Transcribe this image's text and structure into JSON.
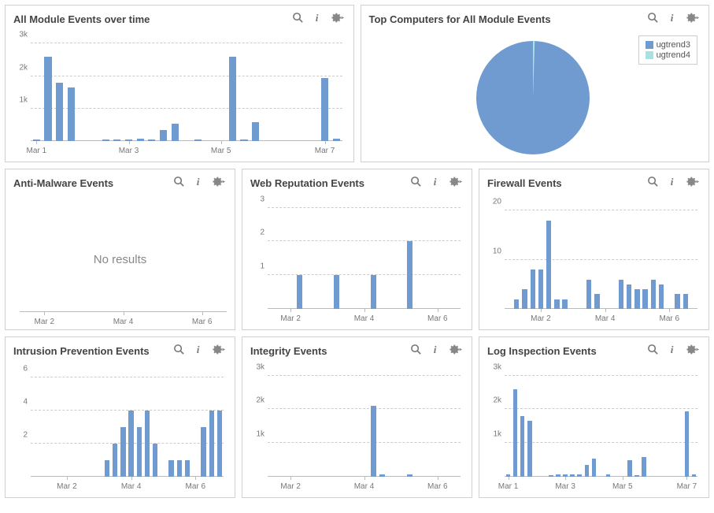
{
  "colors": {
    "bar": "#6f9bd1",
    "grid": "#cccccc",
    "axis": "#bbbbbb",
    "pie1": "#6f9bd1",
    "pie2": "#a8e2e0"
  },
  "panels": {
    "all_module": {
      "title": "All Module Events over time"
    },
    "top_computers": {
      "title": "Top Computers for All Module Events"
    },
    "anti_malware": {
      "title": "Anti-Malware Events",
      "no_results": "No results"
    },
    "web_rep": {
      "title": "Web Reputation Events"
    },
    "firewall": {
      "title": "Firewall Events"
    },
    "intrusion": {
      "title": "Intrusion Prevention Events"
    },
    "integrity": {
      "title": "Integrity Events"
    },
    "log_insp": {
      "title": "Log Inspection Events"
    }
  },
  "legend": {
    "items": [
      "ugtrend3",
      "ugtrend4"
    ]
  },
  "chart_data": [
    {
      "id": "all_module",
      "type": "bar",
      "title": "All Module Events over time",
      "y_ticks": [
        1000,
        2000,
        3000
      ],
      "y_tick_labels": [
        "1k",
        "2k",
        "3k"
      ],
      "ylim": [
        0,
        3200
      ],
      "x_ticks": [
        "Mar 1",
        "Mar 3",
        "Mar 5",
        "Mar 7"
      ],
      "n_slots": 27,
      "x_tick_positions": [
        0,
        8,
        16,
        25
      ],
      "values": [
        60,
        2600,
        1800,
        1650,
        0,
        0,
        40,
        60,
        60,
        80,
        60,
        350,
        540,
        0,
        60,
        0,
        0,
        2600,
        40,
        580,
        0,
        0,
        0,
        0,
        0,
        1950,
        80
      ]
    },
    {
      "id": "top_computers",
      "type": "pie",
      "title": "Top Computers for All Module Events",
      "series": [
        {
          "name": "ugtrend3",
          "value": 99.5,
          "color": "#6f9bd1"
        },
        {
          "name": "ugtrend4",
          "value": 0.5,
          "color": "#a8e2e0"
        }
      ]
    },
    {
      "id": "anti_malware",
      "type": "bar",
      "title": "Anti-Malware Events",
      "no_results": true,
      "x_ticks": [
        "Mar 2",
        "Mar 4",
        "Mar 6"
      ],
      "n_slots": 21,
      "x_tick_positions": [
        2,
        10,
        18
      ],
      "values": []
    },
    {
      "id": "web_rep",
      "type": "bar",
      "title": "Web Reputation Events",
      "y_ticks": [
        1,
        2,
        3
      ],
      "y_tick_labels": [
        "1",
        "2",
        "3"
      ],
      "ylim": [
        0,
        3.2
      ],
      "x_ticks": [
        "Mar 2",
        "Mar 4",
        "Mar 6"
      ],
      "n_slots": 21,
      "x_tick_positions": [
        2,
        10,
        18
      ],
      "values": [
        0,
        0,
        0,
        1,
        0,
        0,
        0,
        1,
        0,
        0,
        0,
        1,
        0,
        0,
        0,
        2,
        0,
        0,
        0,
        0,
        0
      ]
    },
    {
      "id": "firewall",
      "type": "bar",
      "title": "Firewall Events",
      "y_ticks": [
        10,
        20
      ],
      "y_tick_labels": [
        "10",
        "20"
      ],
      "ylim": [
        0,
        22
      ],
      "x_ticks": [
        "Mar 2",
        "Mar 4",
        "Mar 6"
      ],
      "n_slots": 24,
      "x_tick_positions": [
        4,
        12,
        20
      ],
      "values": [
        0,
        2,
        4,
        8,
        8,
        18,
        2,
        2,
        0,
        0,
        6,
        3,
        0,
        0,
        6,
        5,
        4,
        4,
        6,
        5,
        0,
        3,
        3,
        0
      ]
    },
    {
      "id": "intrusion",
      "type": "bar",
      "title": "Intrusion Prevention Events",
      "y_ticks": [
        2,
        4,
        6
      ],
      "y_tick_labels": [
        "2",
        "4",
        "6"
      ],
      "ylim": [
        0,
        6.5
      ],
      "x_ticks": [
        "Mar 2",
        "Mar 4",
        "Mar 6"
      ],
      "n_slots": 24,
      "x_tick_positions": [
        4,
        12,
        20
      ],
      "values": [
        0,
        0,
        0,
        0,
        0,
        0,
        0,
        0,
        0,
        1,
        2,
        3,
        4,
        3,
        4,
        2,
        0,
        1,
        1,
        1,
        0,
        3,
        4,
        4
      ]
    },
    {
      "id": "integrity",
      "type": "bar",
      "title": "Integrity Events",
      "y_ticks": [
        1000,
        2000,
        3000
      ],
      "y_tick_labels": [
        "1k",
        "2k",
        "3k"
      ],
      "ylim": [
        0,
        3200
      ],
      "x_ticks": [
        "Mar 2",
        "Mar 4",
        "Mar 6"
      ],
      "n_slots": 21,
      "x_tick_positions": [
        2,
        10,
        18
      ],
      "values": [
        0,
        0,
        0,
        0,
        0,
        0,
        0,
        0,
        0,
        0,
        0,
        2100,
        60,
        0,
        0,
        60,
        0,
        0,
        0,
        0,
        0
      ]
    },
    {
      "id": "log_insp",
      "type": "bar",
      "title": "Log Inspection Events",
      "y_ticks": [
        1000,
        2000,
        3000
      ],
      "y_tick_labels": [
        "1k",
        "2k",
        "3k"
      ],
      "ylim": [
        0,
        3200
      ],
      "x_ticks": [
        "Mar 1",
        "Mar 3",
        "Mar 5",
        "Mar 7"
      ],
      "n_slots": 27,
      "x_tick_positions": [
        0,
        8,
        16,
        25
      ],
      "values": [
        60,
        2600,
        1800,
        1650,
        0,
        0,
        40,
        60,
        60,
        80,
        60,
        350,
        540,
        0,
        60,
        0,
        0,
        500,
        40,
        580,
        0,
        0,
        0,
        0,
        0,
        1950,
        80
      ]
    }
  ]
}
